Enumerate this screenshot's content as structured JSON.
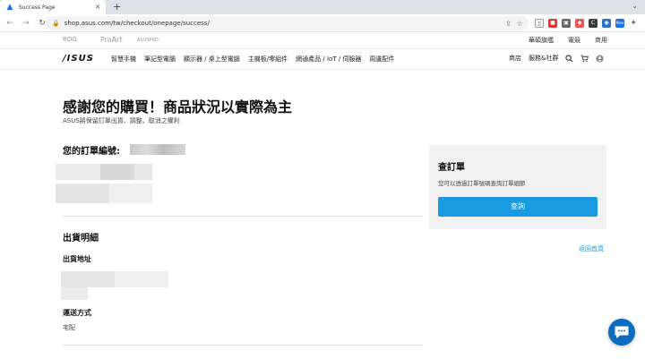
{
  "browser": {
    "tab_title": "Success Page",
    "url": "shop.asus.com/tw/checkout/onepage/success/",
    "new_tab_symbol": "+",
    "close_symbol": "✕",
    "ext_badge": "New"
  },
  "util": {
    "brands": [
      "ROG",
      "ProArt",
      "ASUSPRO"
    ],
    "links": [
      "華碩旗艦",
      "電競",
      "商用"
    ]
  },
  "nav": {
    "logo": "/ISUS",
    "items": [
      "智慧手機",
      "筆記型電腦",
      "顯示器 / 桌上型電腦",
      "主機板/零組件",
      "網通產品 / IoT / 伺服器",
      "周邊配件"
    ],
    "right_items": [
      "商店",
      "服務&社群"
    ]
  },
  "content": {
    "heading": "感謝您的購買！商品狀況以實際為主",
    "subheading": "ASUS將保留訂單出貨、調整、取消之權利",
    "order_label": "您的訂單編號:",
    "shipping_section": "出貨明細",
    "address_label": "出貨地址",
    "method_label": "運送方式",
    "method_value": "宅配"
  },
  "card": {
    "title": "查訂單",
    "desc": "您可以透過訂單號碼查詢訂單細節",
    "button": "查詢"
  },
  "back_link": "返回首頁",
  "colors": {
    "accent": "#1a9ae0",
    "card_bg": "#f2f2f2",
    "fab": "#0a6cc1"
  }
}
